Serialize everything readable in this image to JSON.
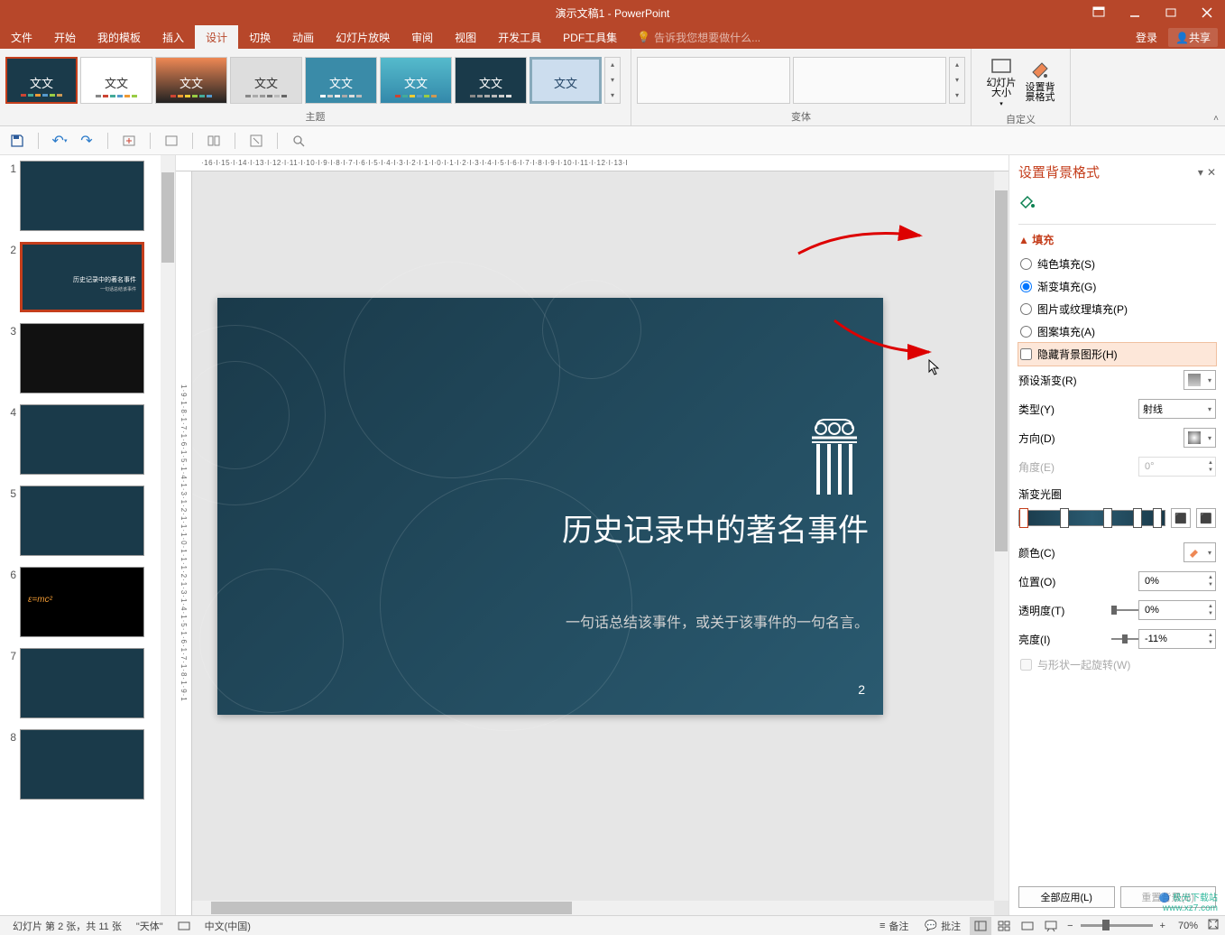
{
  "title": "演示文稿1 - PowerPoint",
  "menu": {
    "tabs": [
      "文件",
      "开始",
      "我的模板",
      "插入",
      "设计",
      "切换",
      "动画",
      "幻灯片放映",
      "审阅",
      "视图",
      "开发工具",
      "PDF工具集"
    ],
    "active": "设计",
    "tell_me": "告诉我您想要做什么...",
    "login": "登录",
    "share": "共享"
  },
  "ribbon": {
    "theme_label": "主题",
    "variant_label": "变体",
    "custom_label": "自定义",
    "slide_size": "幻灯片大小",
    "bg_format": "设置背景格式",
    "theme_text": "文文"
  },
  "slides": {
    "count": 8,
    "selected": 2
  },
  "canvas": {
    "title": "历史记录中的著名事件",
    "subtitle": "一句话总结该事件，或关于该事件的一句名言。",
    "page_num": "2"
  },
  "ruler_h": "·16·I·15·I·14·I·13·I·12·I·11·I·10·I·9·I·8·I·7·I·6·I·5·I·4·I·3·I·2·I·1·I·0·I·1·I·2·I·3·I·4·I·5·I·6·I·7·I·8·I·9·I·10·I·11·I·12·I·13·I",
  "ruler_v": "1·9·1·8·1·7·1·6·1·5·1·4·1·3·1·2·1·1·1·0·1·1·1·2·1·3·1·4·1·5·1·6·1·7·1·8·1·9·1",
  "pane": {
    "title": "设置背景格式",
    "fill_section": "填充",
    "solid": "纯色填充(S)",
    "gradient": "渐变填充(G)",
    "picture": "图片或纹理填充(P)",
    "pattern": "图案填充(A)",
    "hide_bg": "隐藏背景图形(H)",
    "preset": "预设渐变(R)",
    "type_label": "类型(Y)",
    "type_val": "射线",
    "direction": "方向(D)",
    "angle": "角度(E)",
    "angle_val": "0°",
    "stops": "渐变光圈",
    "color": "颜色(C)",
    "position": "位置(O)",
    "position_val": "0%",
    "transparency": "透明度(T)",
    "transparency_val": "0%",
    "brightness": "亮度(I)",
    "brightness_val": "-11%",
    "rotate_shape": "与形状一起旋转(W)",
    "apply_all": "全部应用(L)",
    "reset_bg": "重置背景(B)"
  },
  "status": {
    "slide_info": "幻灯片 第 2 张，共 11 张",
    "theme_name": "\"天体\"",
    "language": "中文(中国)",
    "notes": "备注",
    "comments": "批注",
    "zoom": "70%"
  },
  "watermark": {
    "l1": "极光下载站",
    "l2": "www.xz7.com"
  }
}
